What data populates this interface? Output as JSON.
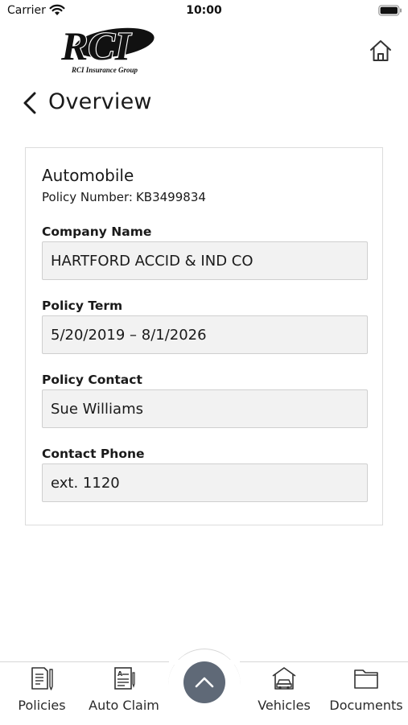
{
  "status_bar": {
    "carrier": "Carrier",
    "time": "10:00"
  },
  "header": {
    "logo_text": "RCI",
    "logo_tagline": "RCI Insurance Group",
    "title": "Overview"
  },
  "policy": {
    "type": "Automobile",
    "number_label": "Policy Number:",
    "number_value": "KB3499834",
    "fields": [
      {
        "label": "Company Name",
        "value": "HARTFORD ACCID & IND CO"
      },
      {
        "label": "Policy Term",
        "value": "5/20/2019 – 8/1/2026"
      },
      {
        "label": "Policy Contact",
        "value": "Sue Williams"
      },
      {
        "label": "Contact Phone",
        "value": "ext. 1120"
      }
    ]
  },
  "tab_bar": {
    "items": [
      {
        "label": "Policies",
        "icon": "policy-document-icon"
      },
      {
        "label": "Auto Claim",
        "icon": "claim-form-icon"
      },
      {
        "label": "Vehicles",
        "icon": "garage-car-icon"
      },
      {
        "label": "Documents",
        "icon": "folder-icon"
      }
    ],
    "center_button_icon": "chevron-up-icon"
  },
  "colors": {
    "fab": "#5f6977",
    "field_background": "#f2f2f2",
    "field_border": "#cfcfcf",
    "card_border": "#dcdcdc"
  }
}
